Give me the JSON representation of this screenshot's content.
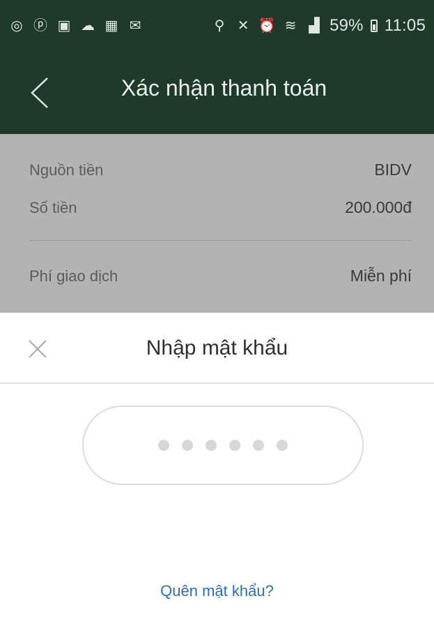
{
  "status_bar": {
    "left_icons": [
      "whatsapp-icon",
      "pinterest-icon",
      "file-icon",
      "cloud-icon",
      "gmail-icon",
      "mail-icon"
    ],
    "right_icons": [
      "location-icon",
      "mute-icon",
      "alarm-icon",
      "wifi-icon",
      "signal-icon"
    ],
    "battery_percent": "59%",
    "time": "11:05"
  },
  "header": {
    "title": "Xác nhận thanh toán"
  },
  "details": {
    "source_label": "Nguồn tiền",
    "source_value": "BIDV",
    "amount_label": "Số tiền",
    "amount_value": "200.000đ",
    "fee_label": "Phí giao dịch",
    "fee_value": "Miễn phí"
  },
  "password_sheet": {
    "title": "Nhập mật khẩu",
    "pin_length": 6,
    "forgot_link": "Quên mật khẩu?"
  },
  "colors": {
    "header_bg": "#1f3a2b",
    "overlay_gray": "#b3b3b3",
    "link_blue": "#2c6fb3"
  }
}
